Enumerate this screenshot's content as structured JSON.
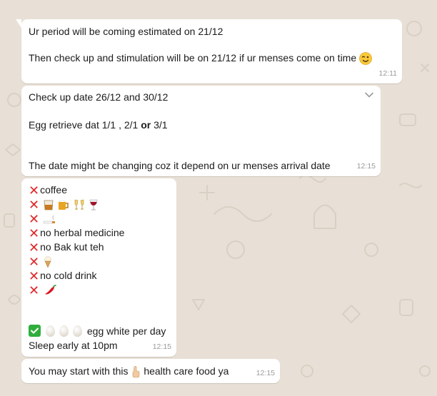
{
  "messages": [
    {
      "lines": [
        "Ur period will be coming estimated on 21/12",
        "Then check up and stimulation will be on 21/12 if ur menses come on time"
      ],
      "emoji": "winking-face-icon",
      "time": "12:11"
    },
    {
      "lines": [
        "Check up date 26/12 and  30/12",
        "Egg retrieve dat 1/1 , 2/1 ",
        "or",
        " 3/1",
        "The date might be changing coz it depend on ur menses arrival date"
      ],
      "time": "12:15"
    },
    {
      "items": [
        "coffee",
        "no herbal medicine",
        "no Bak kut teh",
        "no cold drink"
      ],
      "egg_text": "egg white per day",
      "sleep": "Sleep early at 10pm",
      "time": "12:15"
    },
    {
      "before": "You may start with this ",
      "after": " health care food ya",
      "time": "12:15"
    }
  ],
  "colors": {
    "wallpaper": "#e8e0d6",
    "bubble": "#ffffff",
    "timestamp": "#9a9a9a",
    "cross": "#e02727",
    "check": "#2fae3d"
  }
}
